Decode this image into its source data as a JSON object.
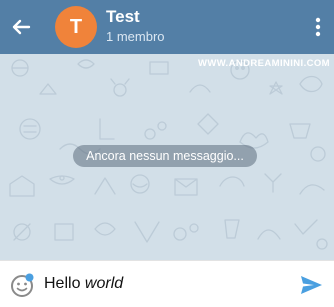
{
  "header": {
    "avatar_letter": "T",
    "title": "Test",
    "subtitle": "1 membro",
    "back_icon": "arrow-left-icon",
    "menu_icon": "more-vertical-icon"
  },
  "chat": {
    "watermark": "WWW.ANDREAMININI.COM",
    "empty_text": "Ancora nessun messaggio..."
  },
  "composer": {
    "text_plain": "Hello ",
    "text_italic": "world",
    "emoji_icon": "emoji-icon",
    "send_icon": "send-icon"
  },
  "colors": {
    "appbar": "#537fa6",
    "avatar": "#f0833a",
    "send": "#4a9fe0"
  }
}
